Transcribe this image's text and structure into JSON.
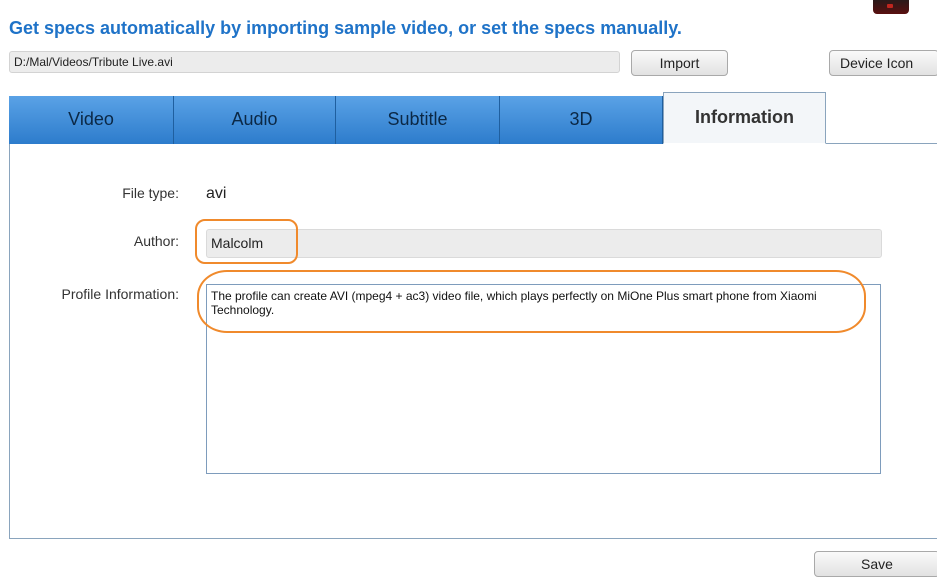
{
  "header": {
    "title": "Get specs automatically by importing sample video, or set the specs manually."
  },
  "import_bar": {
    "path_value": "D:/Mal/Videos/Tribute Live.avi",
    "import_label": "Import",
    "device_icon_label": "Device Icon"
  },
  "tabs": [
    {
      "label": "Video"
    },
    {
      "label": "Audio"
    },
    {
      "label": "Subtitle"
    },
    {
      "label": "3D"
    },
    {
      "label": "Information",
      "active": true
    }
  ],
  "info": {
    "file_type_label": "File type:",
    "file_type_value": "avi",
    "author_label": "Author:",
    "author_value": "Malcolm",
    "profile_label": "Profile Information:",
    "profile_value": "The profile can create AVI (mpeg4 + ac3) video file, which plays perfectly on MiOne Plus smart phone from Xiaomi Technology."
  },
  "footer": {
    "save_label": "Save"
  },
  "colors": {
    "title_blue": "#1f73c8",
    "tab_blue": "#3d8cd9",
    "highlight_orange": "#f08a2c"
  }
}
